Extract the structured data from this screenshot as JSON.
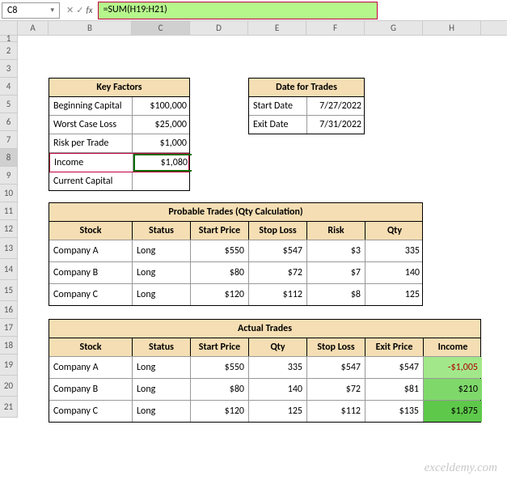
{
  "nameBox": "C8",
  "formula": "=SUM(H19:H21)",
  "columns": [
    "",
    "A",
    "B",
    "C",
    "D",
    "E",
    "F",
    "G",
    "H"
  ],
  "rows": [
    "1",
    "2",
    "3",
    "4",
    "5",
    "6",
    "7",
    "8",
    "9",
    "10",
    "11",
    "12",
    "13",
    "14",
    "15",
    "16",
    "17",
    "18",
    "19",
    "20",
    "21"
  ],
  "keyFactors": {
    "title": "Key Factors",
    "rows": [
      {
        "label": "Beginning Capital",
        "value": "$100,000"
      },
      {
        "label": "Worst Case Loss",
        "value": "$25,000"
      },
      {
        "label": "Risk per Trade",
        "value": "$1,000"
      },
      {
        "label": "Income",
        "value": "$1,080"
      },
      {
        "label": "Current Capital",
        "value": ""
      }
    ]
  },
  "dateTrades": {
    "title": "Date for Trades",
    "rows": [
      {
        "label": "Start Date",
        "value": "7/27/2022"
      },
      {
        "label": "Exit Date",
        "value": "7/31/2022"
      }
    ]
  },
  "probable": {
    "title": "Probable Trades (Qty Calculation)",
    "headers": [
      "Stock",
      "Status",
      "Start Price",
      "Stop Loss",
      "Risk",
      "Qty"
    ],
    "rows": [
      {
        "stock": "Company A",
        "status": "Long",
        "start": "$550",
        "stop": "$547",
        "risk": "$3",
        "qty": "335"
      },
      {
        "stock": "Company B",
        "status": "Long",
        "start": "$80",
        "stop": "$72",
        "risk": "$7",
        "qty": "140"
      },
      {
        "stock": "Company C",
        "status": "Long",
        "start": "$120",
        "stop": "$112",
        "risk": "$8",
        "qty": "125"
      }
    ]
  },
  "actual": {
    "title": "Actual Trades",
    "headers": [
      "Stock",
      "Status",
      "Start Price",
      "Qty",
      "Stop Loss",
      "Exit Price",
      "Income"
    ],
    "rows": [
      {
        "stock": "Company A",
        "status": "Long",
        "start": "$550",
        "qty": "335",
        "stop": "$547",
        "exit": "$547",
        "income": "-$1,005"
      },
      {
        "stock": "Company B",
        "status": "Long",
        "start": "$80",
        "qty": "140",
        "stop": "$72",
        "exit": "$81",
        "income": "$210"
      },
      {
        "stock": "Company C",
        "status": "Long",
        "start": "$120",
        "qty": "125",
        "stop": "$112",
        "exit": "$135",
        "income": "$1,875"
      }
    ]
  },
  "watermark": "exceldemy.com"
}
